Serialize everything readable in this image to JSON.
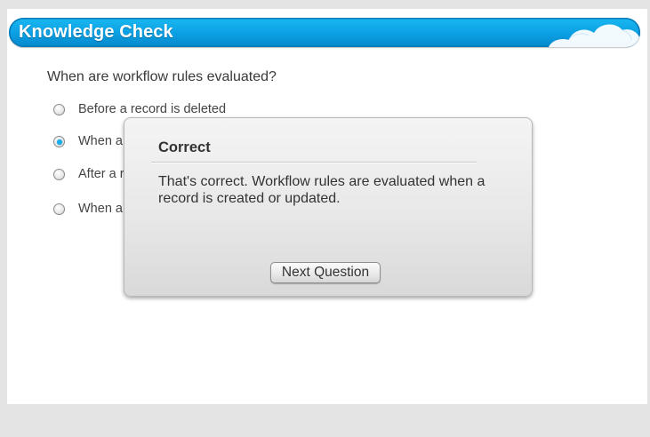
{
  "header": {
    "title": "Knowledge Check"
  },
  "quiz": {
    "question": "When are workflow rules evaluated?",
    "options": [
      {
        "label": "Before a record is deleted",
        "selected": false
      },
      {
        "label": "When a",
        "selected": true
      },
      {
        "label": "After a r",
        "selected": false
      },
      {
        "label": "When a",
        "selected": false
      }
    ]
  },
  "dialog": {
    "title": "Correct",
    "message": "That's correct. Workflow rules are evaluated when a record is created or updated.",
    "button_label": "Next Question"
  },
  "colors": {
    "header_blue": "#0b9fe2",
    "radio_selected": "#19aee8"
  }
}
